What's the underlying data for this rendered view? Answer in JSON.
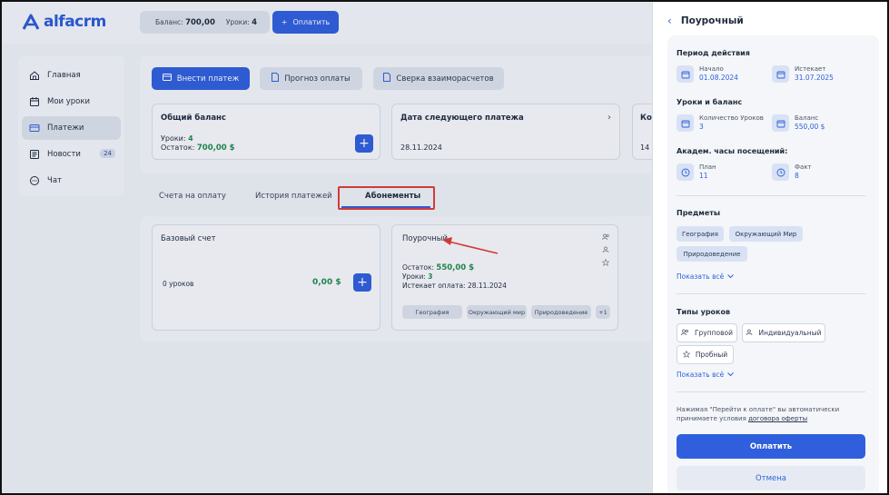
{
  "app": {
    "logo_text": "alfacrm"
  },
  "topbar": {
    "balance_label": "Баланс:",
    "balance_value": "700,00",
    "lessons_label": "Уроки:",
    "lessons_value": "4",
    "pay_label": "Оплатить"
  },
  "sidebar": {
    "items": [
      {
        "label": "Главная",
        "icon": "home-icon"
      },
      {
        "label": "Мои уроки",
        "icon": "calendar-icon"
      },
      {
        "label": "Платежи",
        "icon": "card-icon"
      },
      {
        "label": "Новости",
        "icon": "news-icon",
        "badge": "24"
      },
      {
        "label": "Чат",
        "icon": "chat-icon"
      }
    ]
  },
  "actions": {
    "deposit": "Внести платеж",
    "forecast": "Прогноз оплаты",
    "reconcile": "Сверка взаиморасчетов"
  },
  "summary": {
    "total_title": "Общий баланс",
    "lessons_label": "Уроки:",
    "lessons_value": "4",
    "remain_label": "Остаток:",
    "remain_value": "700,00 $",
    "next_title": "Дата следующего платежа",
    "next_date": "28.11.2024",
    "third_title": "Ко",
    "third_value": "14"
  },
  "tabs": [
    {
      "label": "Счета на оплату"
    },
    {
      "label": "История платежей"
    },
    {
      "label": "Абонементы"
    }
  ],
  "subscriptions": {
    "base": {
      "title": "Базовый счет",
      "lessons": "0 уроков",
      "amount": "0,00 $"
    },
    "hourly": {
      "title": "Поурочный",
      "remain_label": "Остаток:",
      "remain_value": "550,00 $",
      "lessons_label": "Уроки:",
      "lessons_value": "3",
      "expires_label": "Истекает оплата:",
      "expires_value": "28.11.2024",
      "chips": [
        "География",
        "Окружающий мир",
        "Природоведение",
        "+1"
      ]
    }
  },
  "drawer": {
    "title": "Поурочный",
    "period": {
      "title": "Период действия",
      "start_label": "Начало",
      "start_value": "01.08.2024",
      "end_label": "Истекает",
      "end_value": "31.07.2025"
    },
    "lessons": {
      "title": "Уроки и баланс",
      "count_label": "Количество Уроков",
      "count_value": "3",
      "balance_label": "Баланс",
      "balance_value": "550,00 $"
    },
    "hours": {
      "title": "Академ. часы посещений:",
      "plan_label": "План",
      "plan_value": "11",
      "fact_label": "Факт",
      "fact_value": "8"
    },
    "subjects": {
      "title": "Предметы",
      "items": [
        "География",
        "Окружающий Мир",
        "Природоведение"
      ],
      "show_all": "Показать всё"
    },
    "types": {
      "title": "Типы уроков",
      "items": [
        "Групповой",
        "Индивидуальный",
        "Пробный"
      ],
      "show_all": "Показать всё"
    },
    "note_text": "Нажимая \"Перейти к оплате\" вы автоматически принимаете условия",
    "note_link": "договора оферты",
    "pay": "Оплатить",
    "cancel": "Отмена"
  },
  "colors": {
    "accent": "#2f5fdc",
    "highlight": "#e03b36",
    "success": "#1f8a4c"
  }
}
